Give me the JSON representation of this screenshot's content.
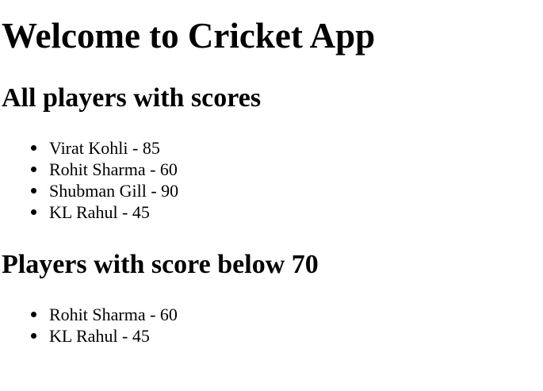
{
  "header": {
    "title": "Welcome to Cricket App"
  },
  "sections": {
    "all_players": {
      "title": "All players with scores",
      "items": [
        "Virat Kohli - 85",
        "Rohit Sharma - 60",
        "Shubman Gill - 90",
        "KL Rahul - 45"
      ]
    },
    "below_70": {
      "title": "Players with score below 70",
      "items": [
        "Rohit Sharma - 60",
        "KL Rahul - 45"
      ]
    }
  }
}
